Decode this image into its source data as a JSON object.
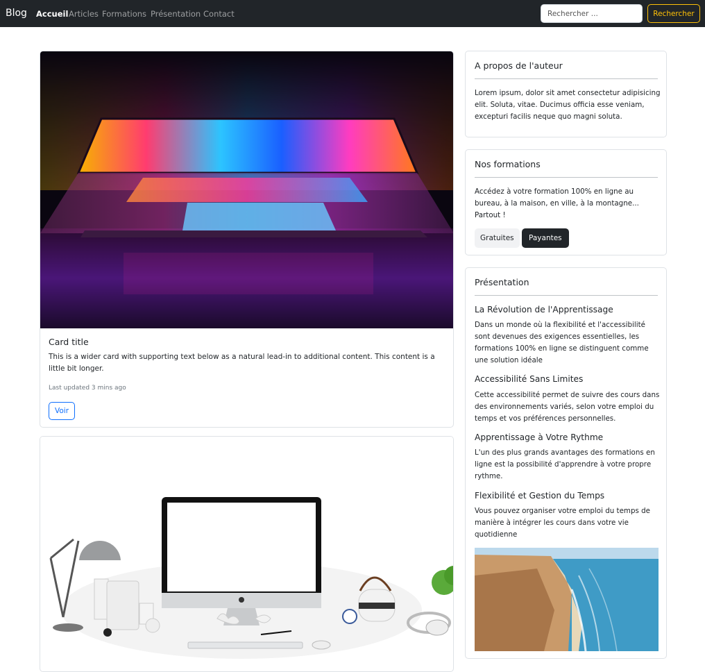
{
  "navbar": {
    "brand": "Blog",
    "links": [
      "Accueil",
      "Articles",
      "Formations",
      "Présentation",
      "Contact"
    ],
    "active_link": "Accueil",
    "search_placeholder": "Rechercher ...",
    "search_button": "Rechercher",
    "accent_color": "#ffc107",
    "background_color": "#212529"
  },
  "main": {
    "card1": {
      "image": "colorful-laptop-photo",
      "title": "Card title",
      "text": "This is a wider card with supporting text below as a natural lead-in to additional content. This content is a little bit longer.",
      "updated": "Last updated 3 mins ago",
      "button": "Voir"
    },
    "card2": {
      "image": "white-desk-imac-photo"
    }
  },
  "sidebar": {
    "about": {
      "title": "A propos de l'auteur",
      "text": "Lorem ipsum, dolor sit amet consectetur adipisicing elit. Soluta, vitae. Ducimus officia esse veniam, excepturi facilis neque quo magni soluta."
    },
    "formations": {
      "title": "Nos formations",
      "text": "Accédez à votre formation 100% en ligne au bureau, à la maison, en ville, à la montagne... Partout !",
      "button_free": "Gratuites",
      "button_paid": "Payantes"
    },
    "presentation": {
      "title": "Présentation",
      "sections": [
        {
          "title": "La Révolution de l'Apprentissage",
          "text": "Dans un monde où la flexibilité et l'accessibilité sont devenues des exigences essentielles, les formations 100% en ligne se distinguent comme une solution idéale"
        },
        {
          "title": "Accessibilité Sans Limites",
          "text": "Cette accessibilité permet de suivre des cours dans des environnements variés, selon votre emploi du temps et vos préférences personnelles."
        },
        {
          "title": "Apprentissage à Votre Rythme",
          "text": "L'un des plus grands avantages des formations en ligne est la possibilité d'apprendre à votre propre rythme."
        },
        {
          "title": "Flexibilité et Gestion du Temps",
          "text": "Vous pouvez organiser votre emploi du temps de manière à intégrer les cours dans votre vie quotidienne"
        }
      ],
      "image": "coastline-aerial-photo"
    }
  }
}
